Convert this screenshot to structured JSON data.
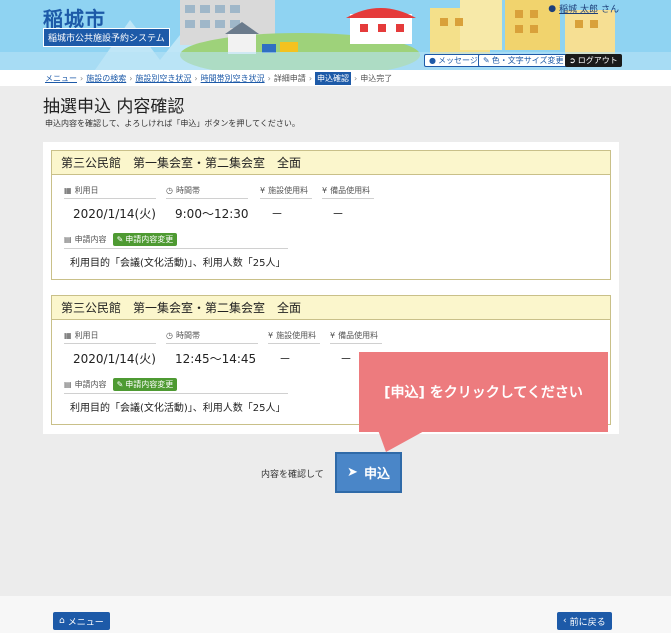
{
  "header": {
    "city": "稲城市",
    "system_name": "稲城市公共施設予約システム",
    "user_name": "稲城 太郎",
    "user_suffix": "さん",
    "message_label": "メッセージ",
    "color_label": "色・文字サイズ変更",
    "logout_label": "ログアウト"
  },
  "breadcrumb": {
    "items": [
      "メニュー",
      "施設の検索",
      "施設別空き状況",
      "時間帯別空き状況",
      "詳細申請",
      "申込確認",
      "申込完了"
    ]
  },
  "page": {
    "title": "抽選申込 内容確認",
    "description": "申込内容を確認して、よろしければ「申込」ボタンを押してください。"
  },
  "labels": {
    "date": "利用日",
    "time": "時間帯",
    "facility_fee": "施設使用料",
    "equipment_fee": "備品使用料",
    "details": "申請内容",
    "change_button": "申請内容変更"
  },
  "applications": [
    {
      "facility": "第三公民館　第一集会室・第二集会室　全面",
      "date": "2020/1/14(火)",
      "time": "9:00～12:30",
      "facility_fee": "－",
      "equipment_fee": "－",
      "purpose": "利用目的「会議(文化活動)」、利用人数「25人」"
    },
    {
      "facility": "第三公民館　第一集会室・第二集会室　全面",
      "date": "2020/1/14(火)",
      "time": "12:45～14:45",
      "facility_fee": "－",
      "equipment_fee": "－",
      "purpose": "利用目的「会議(文化活動)」、利用人数「25人」"
    }
  ],
  "callout": "[申込] をクリックしてください",
  "submit": {
    "lead": "内容を確認して",
    "label": "申込"
  },
  "footer": {
    "menu_label": "メニュー",
    "back_label": "前に戻る"
  },
  "colors": {
    "primary": "#1d5aa8",
    "card_header": "#fbf6cc",
    "change_button": "#4e9a32",
    "callout": "#ed7b7e"
  }
}
